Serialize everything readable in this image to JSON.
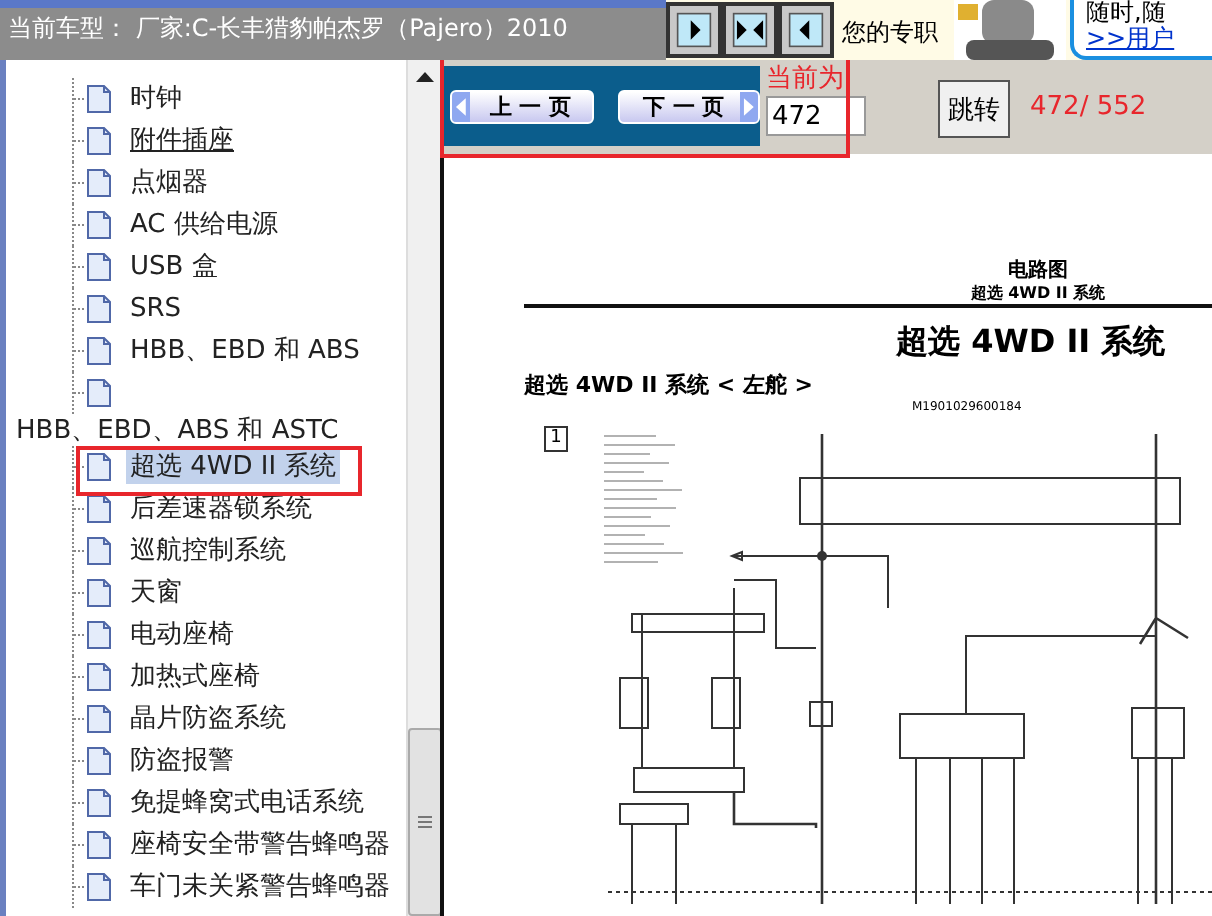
{
  "header": {
    "vehicle": "当前车型： 厂家:C-长丰猎豹帕杰罗（Pajero）2010"
  },
  "promo": {
    "text": "您的专职",
    "bubble_text": "随时,随",
    "link": ">>用户"
  },
  "tree": {
    "items": [
      {
        "kind": "page",
        "label": "时钟",
        "selected": false,
        "hovered": false
      },
      {
        "kind": "page",
        "label": "附件插座",
        "selected": false,
        "hovered": true
      },
      {
        "kind": "page",
        "label": "点烟器",
        "selected": false,
        "hovered": false
      },
      {
        "kind": "page",
        "label": "AC 供给电源",
        "selected": false,
        "hovered": false
      },
      {
        "kind": "page",
        "label": "USB 盒",
        "selected": false,
        "hovered": false
      },
      {
        "kind": "page",
        "label": "SRS",
        "selected": false,
        "hovered": false
      },
      {
        "kind": "page",
        "label": "HBB、EBD 和 ABS",
        "selected": false,
        "hovered": false
      },
      {
        "kind": "page",
        "selected": false,
        "hovered": false
      },
      {
        "kind": "folder",
        "label": "HBB、EBD、ABS 和 ASTC",
        "selected": false,
        "hovered": false
      },
      {
        "kind": "page",
        "label": "超选 4WD II 系统",
        "selected": true,
        "hovered": false
      },
      {
        "kind": "page",
        "label": "后差速器锁系统",
        "selected": false,
        "hovered": false
      },
      {
        "kind": "page",
        "label": "巡航控制系统",
        "selected": false,
        "hovered": false
      },
      {
        "kind": "page",
        "label": "天窗",
        "selected": false,
        "hovered": false
      },
      {
        "kind": "page",
        "label": "电动座椅",
        "selected": false,
        "hovered": false
      },
      {
        "kind": "page",
        "label": "加热式座椅",
        "selected": false,
        "hovered": false
      },
      {
        "kind": "page",
        "label": "晶片防盗系统",
        "selected": false,
        "hovered": false
      },
      {
        "kind": "page",
        "label": "防盗报警",
        "selected": false,
        "hovered": false
      },
      {
        "kind": "page",
        "label": "免提蜂窝式电话系统",
        "selected": false,
        "hovered": false
      },
      {
        "kind": "page",
        "label": "座椅安全带警告蜂鸣器",
        "selected": false,
        "hovered": false
      },
      {
        "kind": "page",
        "label": "车门未关紧警告蜂鸣器",
        "selected": false,
        "hovered": false
      }
    ]
  },
  "pager": {
    "prev": "上 一 页",
    "next": "下 一 页",
    "current_label": "当前为",
    "page_value": "472",
    "jump": "跳转",
    "count": "472/ 552"
  },
  "document": {
    "header_title": "电路图",
    "header_subtitle": "超选 4WD II 系统",
    "title": "超选 4WD II 系统",
    "subtitle": "超选 4WD II 系统 < 左舵 >",
    "code": "M1901029600184",
    "section": "1"
  }
}
